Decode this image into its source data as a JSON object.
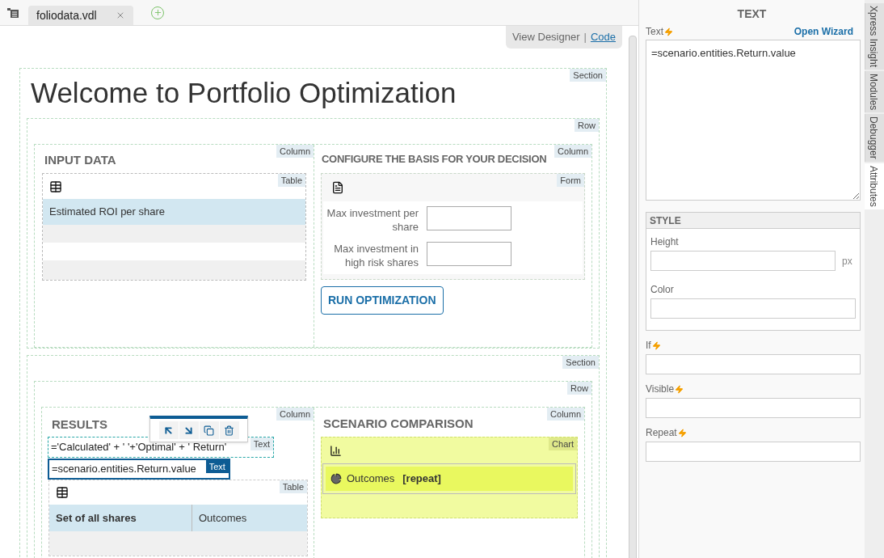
{
  "tabs": [
    {
      "label": "foliodata.vdl",
      "selected": true
    }
  ],
  "view_switch": {
    "options": [
      {
        "label": "View Designer",
        "selected": true
      },
      {
        "label": "Code",
        "selected": false
      }
    ],
    "separator": "|"
  },
  "canvas": {
    "section_tag": "Section",
    "title": "Welcome to Portfolio Optimization",
    "row_tag": "Row",
    "input_column": {
      "tag": "Column",
      "heading": "INPUT DATA",
      "table": {
        "tag": "Table",
        "header": "Estimated ROI per share"
      }
    },
    "config_column": {
      "tag": "Column",
      "heading": "CONFIGURE THE BASIS FOR YOUR DECISION",
      "form": {
        "tag": "Form",
        "fields": [
          {
            "label": "Max investment per share"
          },
          {
            "label": "Max investment in high risk shares"
          }
        ]
      },
      "button": "RUN OPTIMIZATION"
    },
    "section2": {
      "tag": "Section",
      "row_tag": "Row",
      "results": {
        "tag": "Column",
        "heading": "RESULTS",
        "texts": [
          {
            "value": "='Calculated' + ' '+'Optimal' + ' Return'",
            "tag": "Text",
            "selected": false
          },
          {
            "value": "=scenario.entities.Return.value",
            "tag": "Text",
            "selected": true
          }
        ],
        "table": {
          "tag": "Table",
          "columns": [
            "Set of all shares",
            "Outcomes"
          ]
        }
      },
      "comparison": {
        "tag": "Column",
        "heading": "SCENARIO COMPARISON",
        "chart": {
          "tag": "Chart",
          "series_label": "Outcomes",
          "series_badge": "[repeat]"
        }
      }
    }
  },
  "panel": {
    "title": "TEXT",
    "text_label": "Text",
    "wizard": "Open Wizard",
    "text_value": "=scenario.entities.Return.value",
    "style": {
      "title": "STYLE",
      "height_label": "Height",
      "unit": "px",
      "color_label": "Color"
    },
    "fields": [
      {
        "label": "If"
      },
      {
        "label": "Visible"
      },
      {
        "label": "Repeat"
      }
    ]
  },
  "side_tabs": [
    {
      "label": "Xpress Insight",
      "selected": false
    },
    {
      "label": "Modules",
      "selected": false
    },
    {
      "label": "Debugger",
      "selected": false
    },
    {
      "label": "Attributes",
      "selected": true
    }
  ]
}
